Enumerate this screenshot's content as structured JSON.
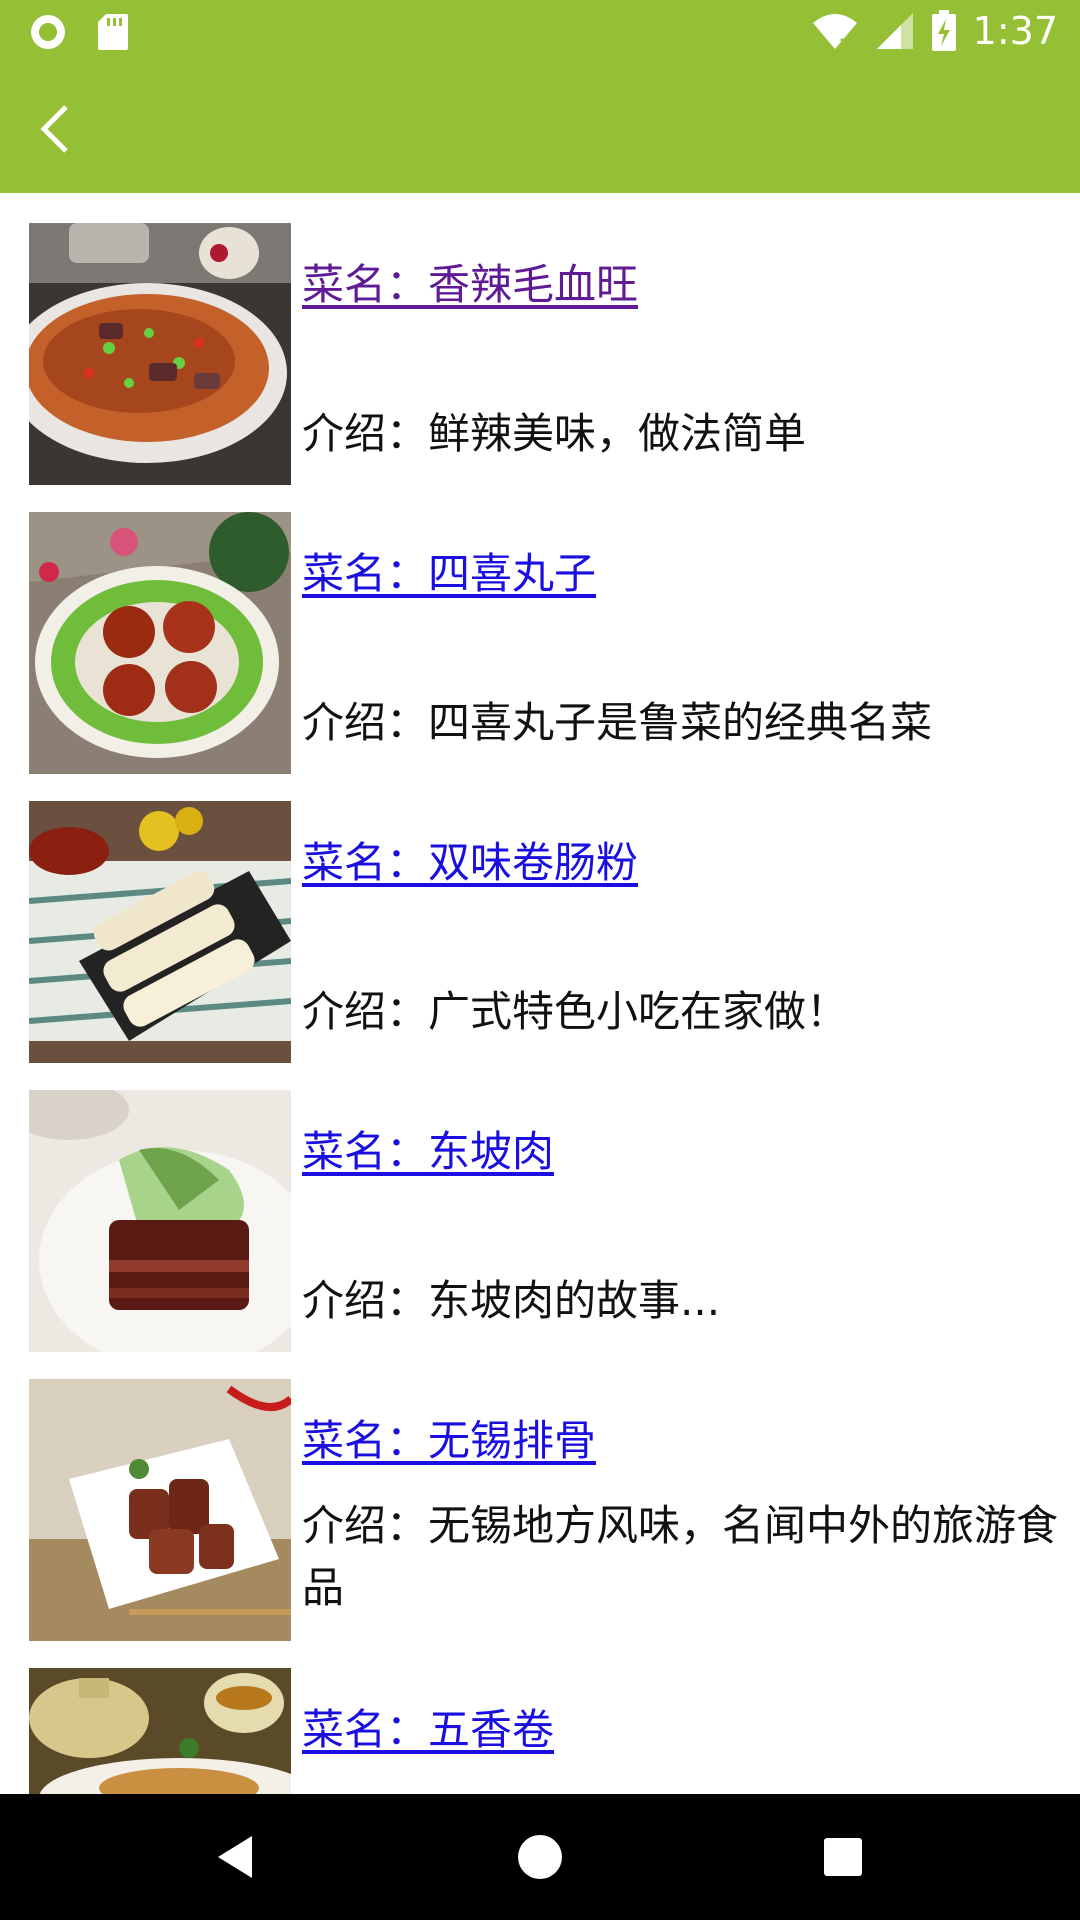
{
  "status_bar": {
    "time": "1:37",
    "left_icons": [
      "circle-notification-icon",
      "sd-card-icon"
    ],
    "right_icons": [
      "wifi-icon",
      "signal-icon",
      "battery-charging-icon"
    ]
  },
  "app_bar": {
    "background": "#95bf34",
    "back_icon": "chevron-left-icon"
  },
  "dishes": [
    {
      "name": "菜名：香辣毛血旺",
      "intro": "介绍：鲜辣美味，做法简单",
      "visited": true
    },
    {
      "name": "菜名：四喜丸子",
      "intro": "介绍：四喜丸子是鲁菜的经典名菜",
      "visited": false
    },
    {
      "name": "菜名：双味卷肠粉",
      "intro": "介绍：广式特色小吃在家做！",
      "visited": false
    },
    {
      "name": "菜名：东坡肉",
      "intro": "介绍：东坡肉的故事...",
      "visited": false
    },
    {
      "name": "菜名：无锡排骨",
      "intro": "介绍：无锡地方风味，名闻中外的旅游食品",
      "visited": false
    },
    {
      "name": "菜名：五香卷",
      "intro": "",
      "visited": false
    }
  ],
  "nav_bar": {
    "back": "triangle-back-icon",
    "home": "circle-home-icon",
    "recents": "square-recents-icon"
  },
  "colors": {
    "link": "#1a0fe0",
    "visited_link": "#5f1a96",
    "accent": "#95bf34"
  }
}
